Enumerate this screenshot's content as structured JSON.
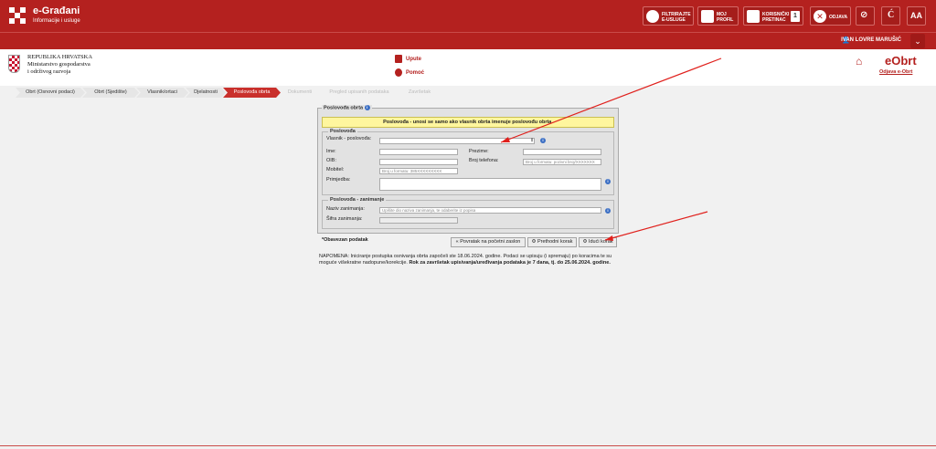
{
  "topbar": {
    "title": "e-Građani",
    "subtitle": "Informacije i usluge",
    "buttons": [
      {
        "label1": "FILTRIRAJTE",
        "label2": "E-USLUGE",
        "icon": "filter-icon"
      },
      {
        "label1": "MOJ",
        "label2": "PROFIL",
        "icon": "profile-icon"
      },
      {
        "label1": "KORISNIČKI",
        "label2": "PRETINAC",
        "icon": "inbox-icon",
        "badge": "1"
      },
      {
        "label1": "ODJAVA",
        "label2": "",
        "icon": "logout-icon"
      }
    ],
    "text_size_small": "Ć",
    "text_size_large": "AA",
    "colors": {
      "brand": "#b4211f"
    }
  },
  "userbar": {
    "user": "IVAN LOVRE MARUŠIĆ",
    "dropdown_glyph": "⌄"
  },
  "header": {
    "ministry_line1": "REPUBLIKA HRVATSKA",
    "ministry_line2": "Ministarstvo gospodarstva",
    "ministry_line3": "i održivog razvoja",
    "link_upute": "Upute",
    "link_pomoc": "Pomoć",
    "app_title": "eObrt",
    "logout": "Odjava e-Obrt"
  },
  "steps": [
    {
      "label": "Obrt (Osnovni podaci)",
      "state": "done"
    },
    {
      "label": "Obrt (Sjedište)",
      "state": "done"
    },
    {
      "label": "Vlasnik/ortaci",
      "state": "done"
    },
    {
      "label": "Djelatnosti",
      "state": "done"
    },
    {
      "label": "Poslovođa obrta",
      "state": "active"
    },
    {
      "label": "Dokumenti",
      "state": "future"
    },
    {
      "label": "Pregled upisanih podataka",
      "state": "future"
    },
    {
      "label": "Završetak",
      "state": "future"
    }
  ],
  "form": {
    "panel_title": "Poslovođa obrta",
    "notice": "Poslovođa - unosi se samo ako vlasnik obrta imenuje poslovođu obrta.",
    "section_poslovodja": "Poslovođa",
    "owner_label": "Vlasnik - poslovođa:",
    "ime_label": "Ime:",
    "ime_value": "",
    "prezime_label": "Prezime:",
    "prezime_value": "",
    "oib_label": "OIB:",
    "oib_value": "",
    "telefon_label": "Broj telefona:",
    "telefon_placeholder": "Broj u formatu: pozivni broj/XXXXXXX",
    "mobitel_label": "Mobitel:",
    "mobitel_placeholder": "Broj u formatu: 385XXXXXXXXX",
    "primjedba_label": "Primjedba:",
    "section_zanimanje": "Poslovođa - zanimanje",
    "naziv_label": "Naziv zanimanja:",
    "naziv_placeholder": "Upišite dio naziva zanimanja, te odaberite iz popisa",
    "sifra_label": "Šifra zanimanja:",
    "info_glyph": "i"
  },
  "required_note": "*Obavezan podatak",
  "buttons": {
    "back_home": "Povratak na početni zaslon",
    "previous": "Prethodni korak",
    "next": "Idući korak"
  },
  "note": {
    "part1": "NAPOMENA: Iniciranje postupka osnivanja obrta započeli ste 18.06.2024. godine. Podaci se upisuju (i spremaju) po koracima te su moguće višekratne nadopune/korekcije. ",
    "part2": "Rok za završetak upisivanja/uređivanja podataka je 7 dana, tj. do 25.06.2024. godine."
  }
}
